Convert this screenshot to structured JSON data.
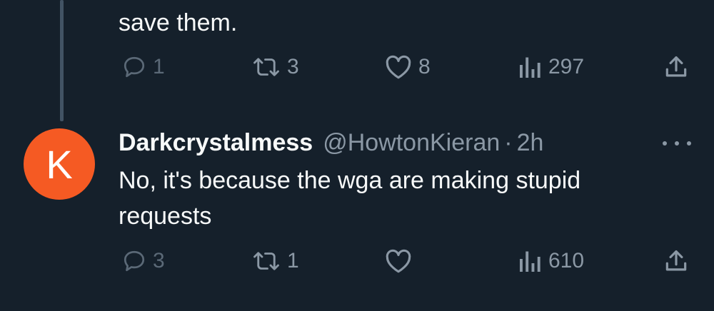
{
  "previous_tweet": {
    "text_tail": "save them.",
    "actions": {
      "replies": "1",
      "retweets": "3",
      "likes": "8",
      "views": "297"
    }
  },
  "reply_tweet": {
    "avatar_letter": "K",
    "avatar_color": "#f55a23",
    "display_name": "Darkcrystalmess",
    "handle": "@HowtonKieran",
    "separator": "·",
    "time": "2h",
    "text": "No, it's because the wga are making stupid requests",
    "actions": {
      "replies": "3",
      "retweets": "1",
      "views": "610"
    }
  },
  "icons": {
    "reply": "reply-icon",
    "retweet": "retweet-icon",
    "like": "heart-icon",
    "views": "views-icon",
    "share": "share-icon",
    "more": "more-icon"
  },
  "colors": {
    "background": "#15202b",
    "text": "#f7f9f9",
    "muted": "#8b98a5",
    "thread_line": "#425364"
  }
}
